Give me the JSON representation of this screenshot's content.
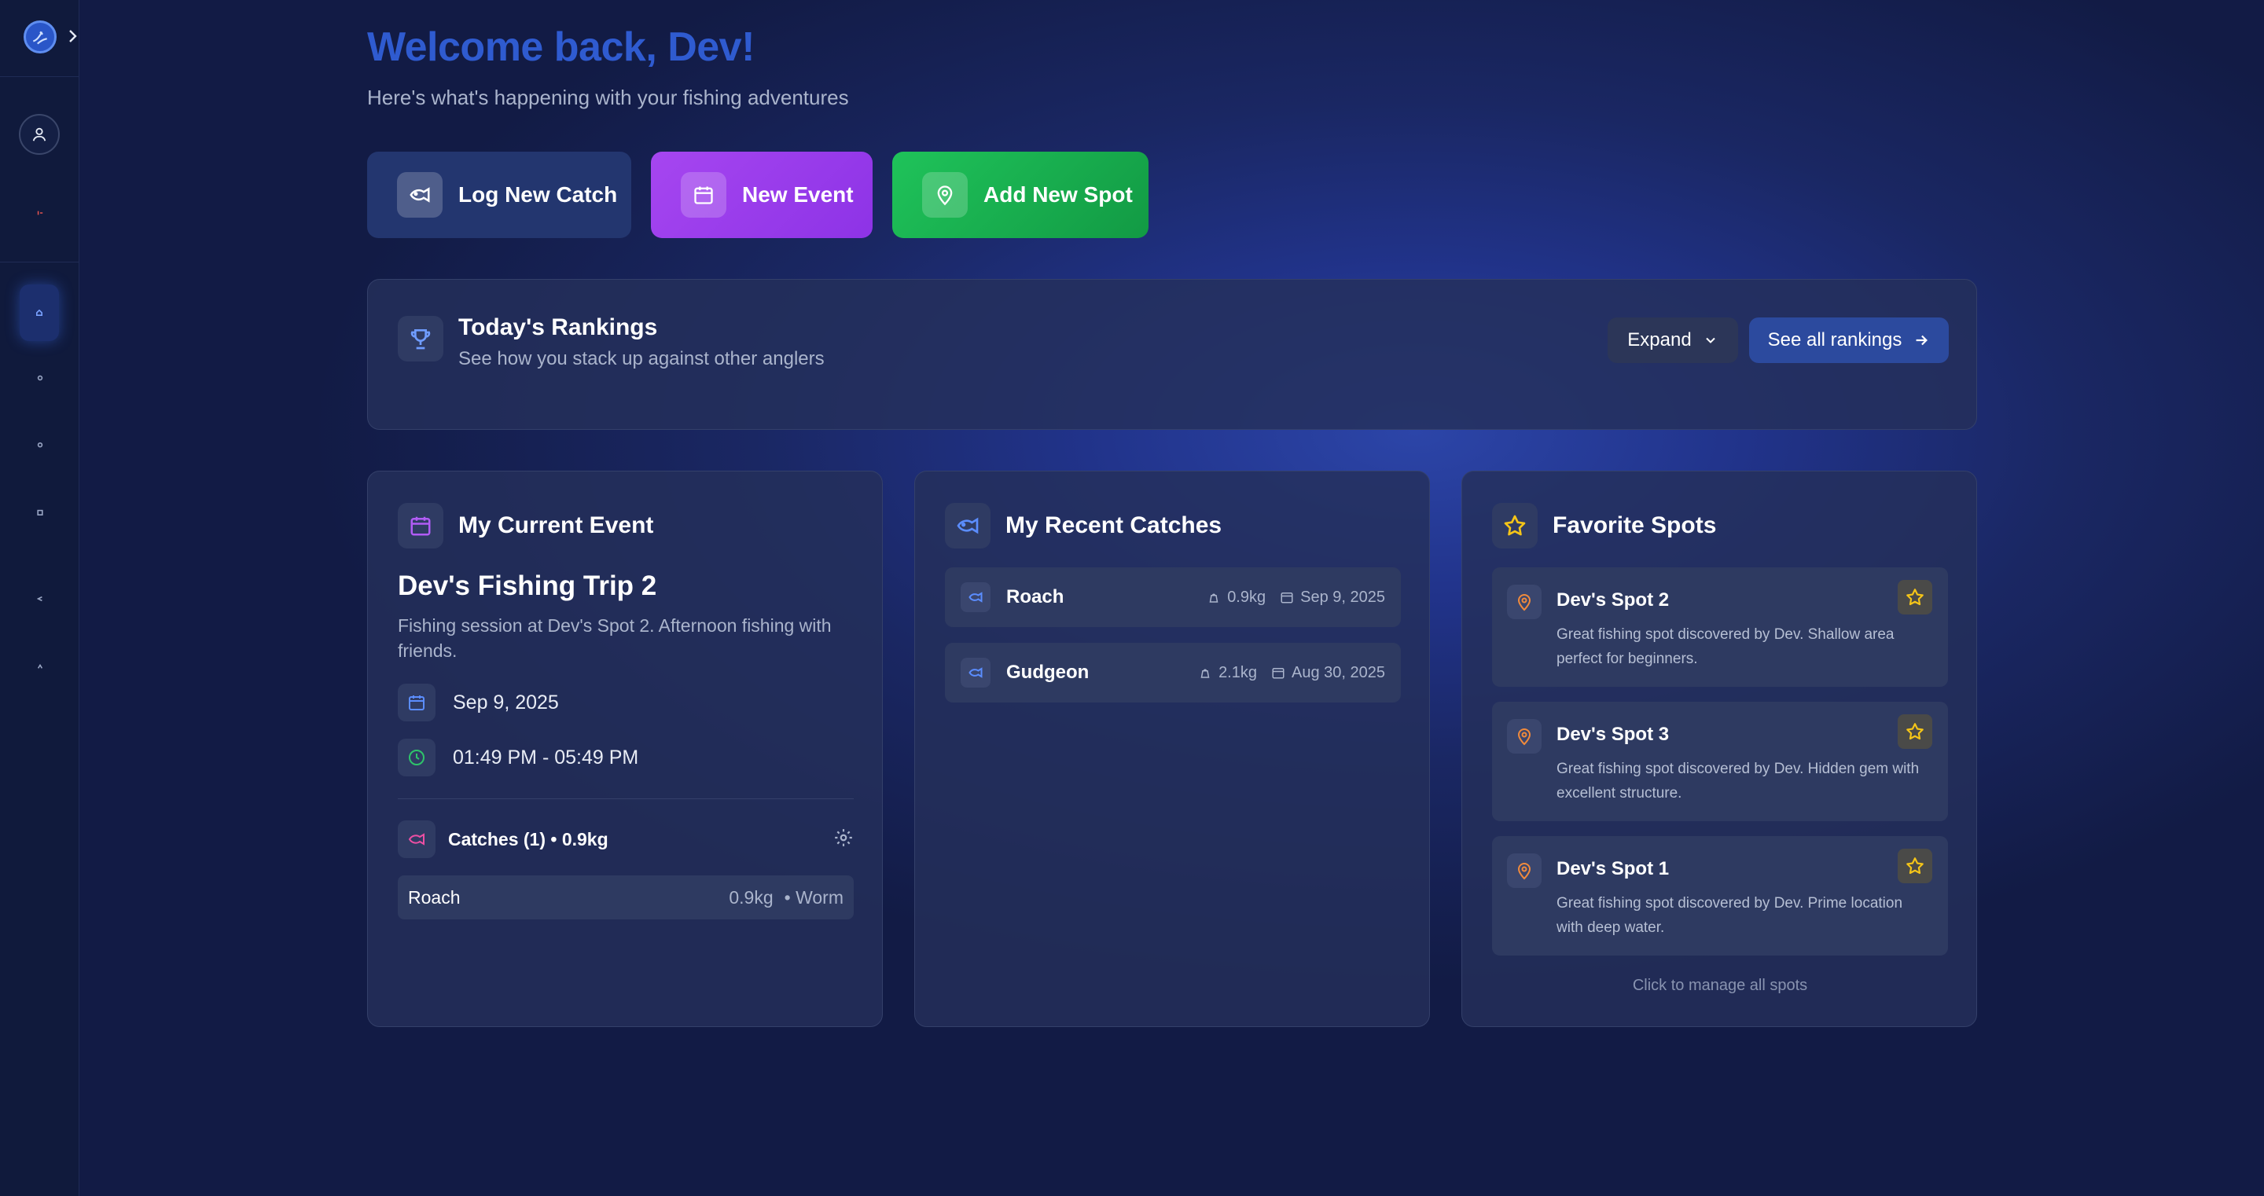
{
  "colors": {
    "primary": "#2f5bd0",
    "event": "#a646f0",
    "spot": "#1fc35a",
    "star": "#f5c518",
    "pin": "#f08a3c"
  },
  "header": {
    "welcome": "Welcome back, Dev!",
    "subtitle": "Here's what's happening with your fishing adventures"
  },
  "quick_actions": [
    {
      "label": "Log New Catch",
      "icon": "fish-icon"
    },
    {
      "label": "New Event",
      "icon": "calendar-icon"
    },
    {
      "label": "Add New Spot",
      "icon": "map-pin-icon"
    }
  ],
  "rankings": {
    "title": "Today's Rankings",
    "description": "See how you stack up against other anglers",
    "expand_label": "Expand",
    "see_all_label": "See all rankings"
  },
  "current_event": {
    "title": "My Current Event",
    "name": "Dev's Fishing Trip 2",
    "description": "Fishing session at Dev's Spot 2. Afternoon fishing with friends.",
    "date": "Sep 9, 2025",
    "time": "01:49 PM - 05:49 PM",
    "catches_header": "Catches (1) • 0.9kg",
    "catches": [
      {
        "species": "Roach",
        "weight": "0.9kg",
        "bait": "• Worm"
      }
    ]
  },
  "recent_catches": {
    "title": "My Recent Catches",
    "items": [
      {
        "species": "Roach",
        "weight": "0.9kg",
        "date": "Sep 9, 2025"
      },
      {
        "species": "Gudgeon",
        "weight": "2.1kg",
        "date": "Aug 30, 2025"
      }
    ]
  },
  "favorite_spots": {
    "title": "Favorite Spots",
    "items": [
      {
        "name": "Dev's Spot 2",
        "description": "Great fishing spot discovered by Dev. Shallow area perfect for beginners."
      },
      {
        "name": "Dev's Spot 3",
        "description": "Great fishing spot discovered by Dev. Hidden gem with excellent structure."
      },
      {
        "name": "Dev's Spot 1",
        "description": "Great fishing spot discovered by Dev. Prime location with deep water."
      }
    ],
    "manage_label": "Click to manage all spots"
  }
}
